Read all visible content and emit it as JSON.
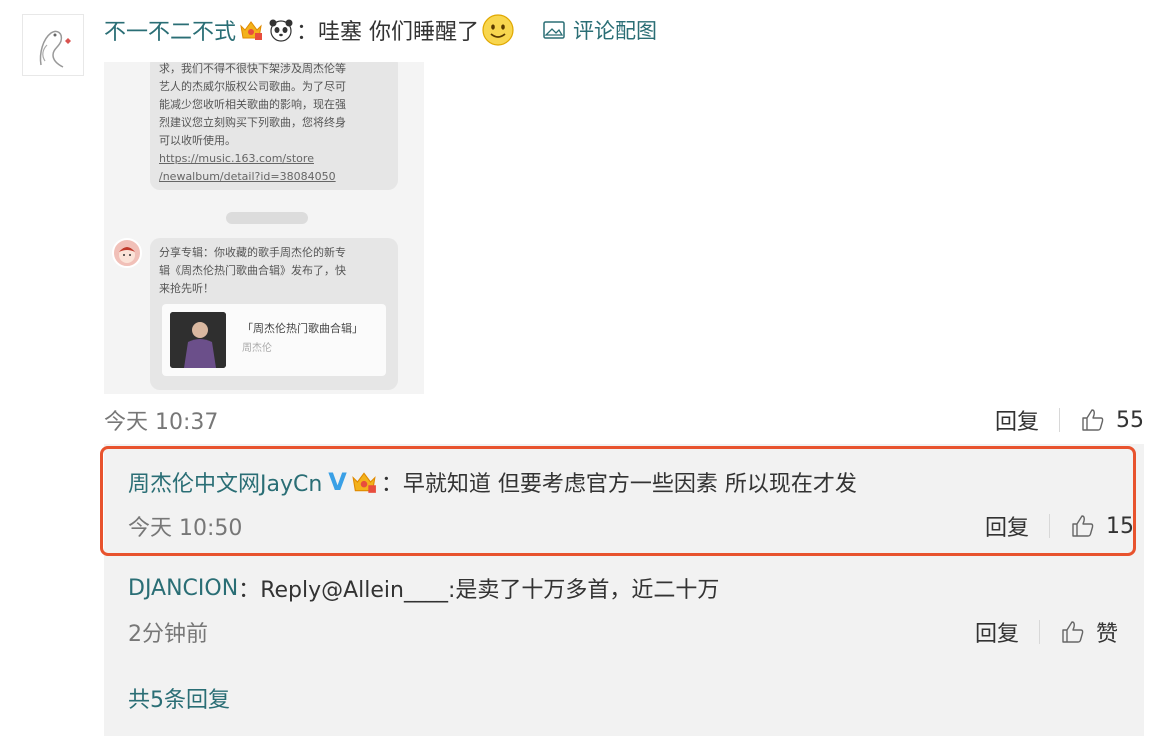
{
  "comment": {
    "username": "不一不二不式",
    "separator": "：",
    "text": "哇塞 你们睡醒了",
    "pic_link_label": "评论配图",
    "time": "今天 10:37",
    "reply_label": "回复",
    "like_count": "55"
  },
  "screenshot": {
    "bubble1_lines": [
      "求，我们不得不很快下架涉及周杰伦等",
      "艺人的杰威尔版权公司歌曲。为了尽可",
      "能减少您收听相关歌曲的影响，现在强",
      "烈建议您立刻购买下列歌曲，您将终身",
      "可以收听使用。"
    ],
    "bubble1_link_lines": [
      "https://music.163.com/store",
      "/newalbum/detail?id=38084050"
    ],
    "bubble2_lines": [
      "分享专辑：你收藏的歌手周杰伦的新专",
      "辑《周杰伦热门歌曲合辑》发布了，快",
      "来抢先听！"
    ],
    "album_title": "「周杰伦热门歌曲合辑」",
    "album_artist": "周杰伦"
  },
  "replies": [
    {
      "username": "周杰伦中文网JayCn",
      "verified_mark": "V",
      "separator": "：",
      "text": "早就知道 但要考虑官方一些因素 所以现在才发",
      "time": "今天 10:50",
      "reply_label": "回复",
      "like_count": "15"
    },
    {
      "username": "DJANCION",
      "separator": "：",
      "text": "Reply@Allein____:是卖了十万多首，近二十万",
      "time": "2分钟前",
      "reply_label": "回复",
      "like_label": "赞"
    }
  ],
  "more_replies": "共5条回复",
  "colors": {
    "link": "#2a6e75",
    "highlight_border": "#e8532e",
    "verified": "#3aa0e6",
    "reply_bg": "#f2f2f2"
  },
  "icons": [
    "avatar-doodle",
    "crown-badge-icon",
    "panda-emoji-icon",
    "smile-emoji-icon",
    "image-icon",
    "thumbs-up-icon",
    "verified-v-icon"
  ]
}
